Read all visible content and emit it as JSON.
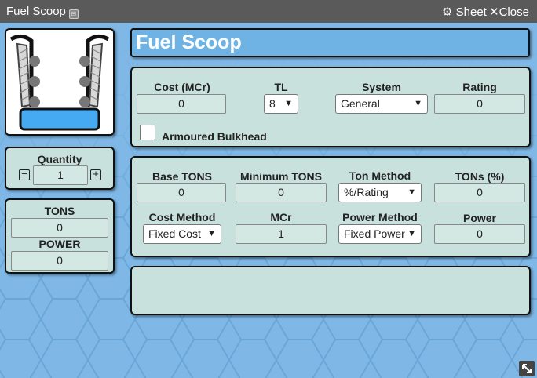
{
  "window": {
    "title": "Fuel Scoop",
    "sheet_label": "Sheet",
    "close_label": "Close"
  },
  "heading": "Fuel Scoop",
  "quantity": {
    "label": "Quantity",
    "value": "1",
    "minus": "−",
    "plus": "+"
  },
  "summary": {
    "tons_label": "TONS",
    "tons_value": "0",
    "power_label": "POWER",
    "power_value": "0"
  },
  "top_panel": {
    "cost_label": "Cost (MCr)",
    "cost_value": "0",
    "tl_label": "TL",
    "tl_value": "8",
    "system_label": "System",
    "system_value": "General",
    "rating_label": "Rating",
    "rating_value": "0",
    "armoured_label": "Armoured Bulkhead"
  },
  "mid_panel": {
    "base_tons_label": "Base TONS",
    "base_tons_value": "0",
    "min_tons_label": "Minimum TONS",
    "min_tons_value": "0",
    "ton_method_label": "Ton Method",
    "ton_method_value": "%/Rating",
    "tons_pct_label": "TONs (%)",
    "tons_pct_value": "0",
    "cost_method_label": "Cost Method",
    "cost_method_value": "Fixed Cost",
    "mcr_label": "MCr",
    "mcr_value": "1",
    "power_method_label": "Power Method",
    "power_method_value": "Fixed Power",
    "power_label": "Power",
    "power_value": "0"
  },
  "icons": [
    "gear-icon",
    "close-icon",
    "resize-icon",
    "fuel-scoop-icon"
  ],
  "colors": {
    "background": "#7fb8e6",
    "panel": "#c9e1dc",
    "heading": "#6fb3e4",
    "titlebar": "#5a5a5a",
    "scoop_accent": "#45aaf2"
  }
}
